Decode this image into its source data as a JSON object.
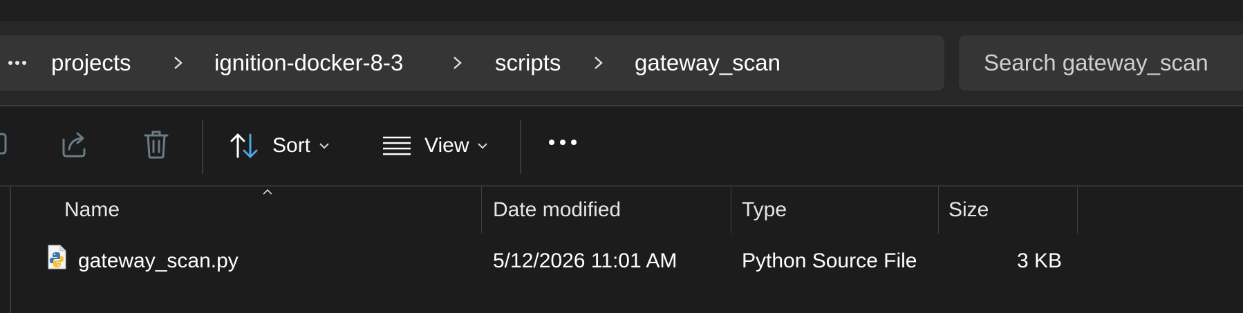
{
  "breadcrumb": {
    "more_label": "...",
    "items": [
      "projects",
      "ignition-docker-8-3",
      "scripts",
      "gateway_scan"
    ]
  },
  "search": {
    "placeholder": "Search gateway_scan"
  },
  "toolbar": {
    "sort_label": "Sort",
    "view_label": "View",
    "more_icon": "more-horizontal-icon",
    "icons": [
      "rename-icon",
      "share-icon",
      "delete-icon",
      "sort-icon",
      "view-lines-icon",
      "chevron-down-icon"
    ]
  },
  "columns": {
    "name": "Name",
    "date_modified": "Date modified",
    "type": "Type",
    "size": "Size",
    "sorted_by": "name"
  },
  "files": [
    {
      "name": "gateway_scan.py",
      "date_modified": "5/12/2026 11:01 AM",
      "type": "Python Source File",
      "size": "3 KB",
      "icon": "python-file-icon"
    }
  ],
  "colors": {
    "background": "#1c1c1c",
    "address_bar": "#272727",
    "input_fill": "#353535",
    "accent_blue": "#4aa8e8",
    "disabled_icon": "#6a7c86"
  }
}
